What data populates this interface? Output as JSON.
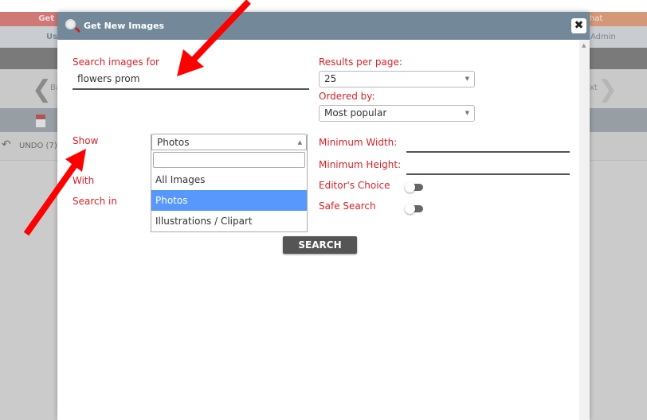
{
  "background": {
    "banner_left": "Get",
    "banner_right": "hat",
    "user_left": "Us",
    "user_right": "Admin",
    "nav_prev": "Ba",
    "nav_next": "xt",
    "undo_label": "UNDO (7)"
  },
  "modal": {
    "title": "Get New Images",
    "close_icon": "close-icon",
    "search_label": "Search images for",
    "search_value": "flowers prom",
    "results_label": "Results per page:",
    "results_value": "25",
    "ordered_label": "Ordered by:",
    "ordered_value": "Most popular",
    "show_label": "Show",
    "with_label": "With",
    "search_in_label": "Search in",
    "show_value": "Photos",
    "show_options": [
      "All Images",
      "Photos",
      "Illustrations / Clipart"
    ],
    "show_selected_index": 1,
    "min_width_label": "Minimum Width:",
    "min_width_value": "",
    "min_height_label": "Minimum Height:",
    "min_height_value": "",
    "editors_choice_label": "Editor's Choice",
    "editors_choice_on": false,
    "safe_search_label": "Safe Search",
    "safe_search_on": false,
    "search_button": "SEARCH"
  },
  "colors": {
    "label_red": "#d81f26",
    "header": "#738898",
    "highlight": "#5897fb",
    "annotation_arrow": "#ff0000"
  }
}
